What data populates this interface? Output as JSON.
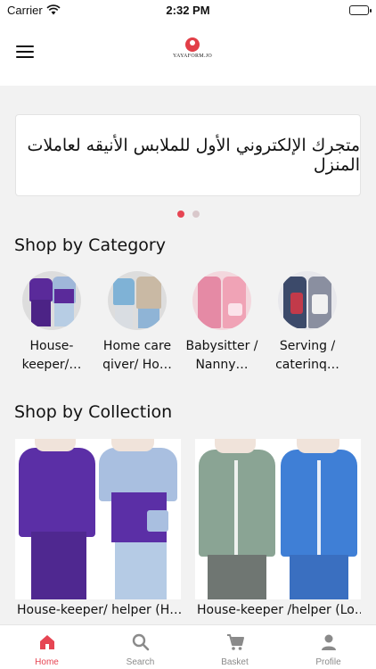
{
  "status_bar": {
    "carrier": "Carrier",
    "time": "2:32 PM"
  },
  "header": {
    "logo_text": "YAYAFORM.JO"
  },
  "banner": {
    "text": "متجرك الإلكتروني الأول للملابس الأنيقه لعاملات المنزل"
  },
  "carousel": {
    "pages": 2,
    "active_index": 0
  },
  "shop_by_category": {
    "title": "Shop by Category",
    "items": [
      {
        "label": "House-keeper/…"
      },
      {
        "label": "Home care qiver/ Ho…"
      },
      {
        "label": "Babysitter / Nanny…"
      },
      {
        "label": "Serving / caterinq…"
      }
    ]
  },
  "shop_by_collection": {
    "title": "Shop by Collection",
    "items": [
      {
        "label": "House-keeper/ helper  (H…"
      },
      {
        "label": "House-keeper /helper (Lo…"
      }
    ]
  },
  "tab_bar": {
    "active": "home",
    "tabs": [
      {
        "id": "home",
        "label": "Home",
        "icon": "home-icon"
      },
      {
        "id": "search",
        "label": "Search",
        "icon": "search-icon"
      },
      {
        "id": "basket",
        "label": "Basket",
        "icon": "basket-icon"
      },
      {
        "id": "profile",
        "label": "Profile",
        "icon": "profile-icon"
      }
    ]
  },
  "colors": {
    "accent": "#e64553",
    "tab_inactive": "#8a8a8a",
    "background": "#f2f2f2"
  }
}
